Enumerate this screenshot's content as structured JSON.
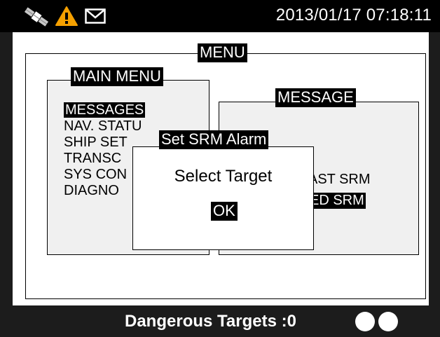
{
  "status": {
    "datetime": "2013/01/17 07:18:11",
    "icons": [
      "satellite-icon",
      "warning-icon",
      "envelope-icon"
    ],
    "accent_warning": "#f5a000"
  },
  "menu_frame": {
    "title": "MENU"
  },
  "main_menu": {
    "title": "MAIN MENU",
    "items": [
      {
        "label": "MESSAGES",
        "selected": true
      },
      {
        "label": "NAV. STATU",
        "selected": false
      },
      {
        "label": "SHIP SET",
        "selected": false
      },
      {
        "label": "TRANSC",
        "selected": false
      },
      {
        "label": "SYS CON",
        "selected": false
      },
      {
        "label": "DIAGNO",
        "selected": false
      }
    ]
  },
  "message_menu": {
    "title": "MESSAGE",
    "items": [
      {
        "label": "AST SRM",
        "selected": false
      },
      {
        "label": "ED SRM",
        "selected": true
      }
    ]
  },
  "dialog": {
    "title": "Set SRM Alarm",
    "message": "Select Target",
    "ok_label": "OK"
  },
  "bottom": {
    "dangerous_targets": "Dangerous Targets :0",
    "indicators": 2
  }
}
